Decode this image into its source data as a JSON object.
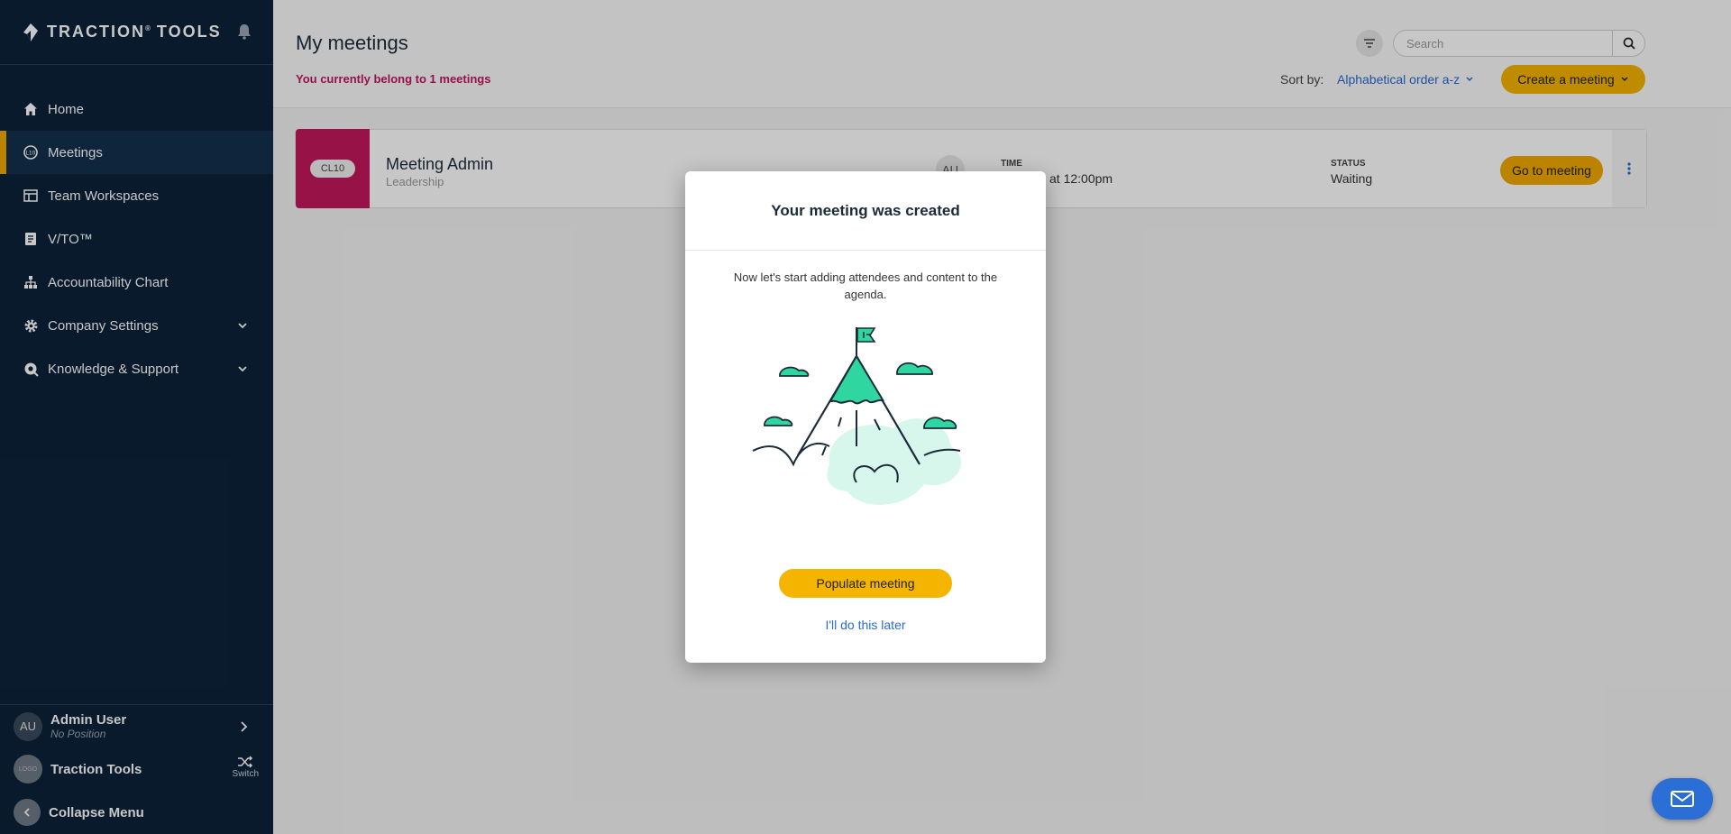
{
  "sidebar": {
    "brand": "TRACTION",
    "brand_mark": "®",
    "brand_suffix": "TOOLS",
    "nav": [
      {
        "label": "Home",
        "icon": "home-icon"
      },
      {
        "label": "Meetings",
        "icon": "meetings-icon",
        "active": true
      },
      {
        "label": "Team Workspaces",
        "icon": "workspace-icon"
      },
      {
        "label": "V/TO™",
        "icon": "document-icon"
      },
      {
        "label": "Accountability Chart",
        "icon": "org-chart-icon"
      },
      {
        "label": "Company Settings",
        "icon": "gear-icon",
        "expandable": true
      },
      {
        "label": "Knowledge & Support",
        "icon": "support-icon",
        "expandable": true
      }
    ],
    "user": {
      "initials": "AU",
      "name": "Admin User",
      "position": "No Position"
    },
    "org": {
      "logo_text": "LOGO",
      "name": "Traction Tools",
      "switch_label": "Switch"
    },
    "collapse_label": "Collapse Menu"
  },
  "header": {
    "title": "My meetings",
    "belong_text": "You currently belong to 1 meetings",
    "search_placeholder": "Search",
    "sort_label": "Sort by:",
    "sort_value": "Alphabetical order a-z",
    "create_label": "Create a meeting"
  },
  "meeting": {
    "tag": "CL10",
    "title": "Meeting Admin",
    "subtitle": "Leadership",
    "attendee_initials": "AU",
    "time_label": "TIME",
    "time_value": "at 12:00pm",
    "status_label": "STATUS",
    "status_value": "Waiting",
    "go_label": "Go to meeting"
  },
  "modal": {
    "title": "Your meeting was created",
    "text": "Now let's start adding attendees and content to the agenda.",
    "populate_label": "Populate meeting",
    "later_label": "I'll do this later"
  },
  "colors": {
    "sidebar_bg": "#0b2239",
    "accent": "#f5b400",
    "meeting_tag": "#c2185b",
    "link": "#2a6ad1",
    "illustration_green": "#2fd6a0"
  }
}
